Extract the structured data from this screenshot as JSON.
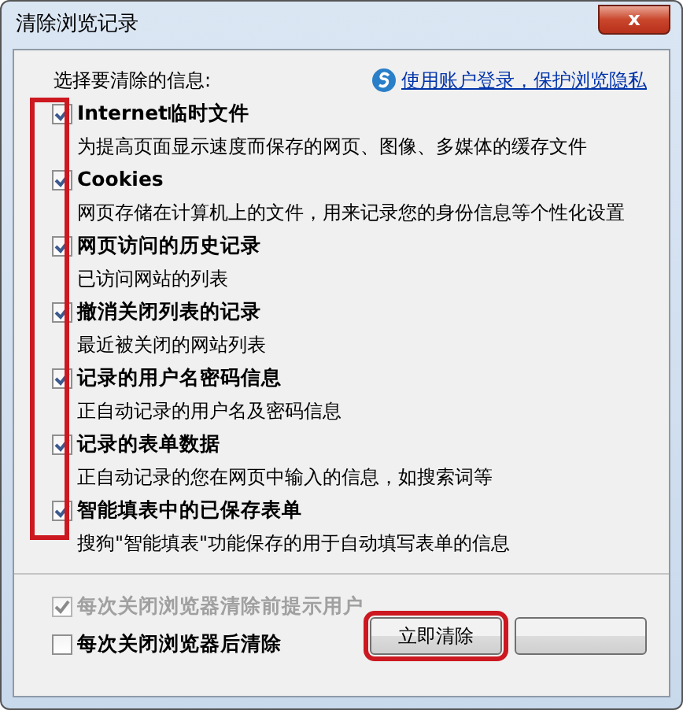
{
  "window": {
    "title": "清除浏览记录",
    "close_label": "x"
  },
  "heading": "选择要清除的信息:",
  "account_link": "使用账户登录，保护浏览隐私",
  "checkbox_column_highlighted": true,
  "items": [
    {
      "label": "Internet临时文件",
      "description": "为提高页面显示速度而保存的网页、图像、多媒体的缓存文件",
      "checked": true
    },
    {
      "label": "Cookies",
      "description": "网页存储在计算机上的文件，用来记录您的身份信息等个性化设置",
      "checked": true
    },
    {
      "label": "网页访问的历史记录",
      "description": "已访问网站的列表",
      "checked": true
    },
    {
      "label": "撤消关闭列表的记录",
      "description": "最近被关闭的网站列表",
      "checked": true
    },
    {
      "label": "记录的用户名密码信息",
      "description": "正自动记录的用户名及密码信息",
      "checked": true
    },
    {
      "label": "记录的表单数据",
      "description": "正自动记录的您在网页中输入的信息，如搜索词等",
      "checked": true
    },
    {
      "label": "智能填表中的已保存表单",
      "description": "搜狗\"智能填表\"功能保存的用于自动填写表单的信息",
      "checked": true
    }
  ],
  "options": [
    {
      "label": "每次关闭浏览器清除前提示用户",
      "checked": true,
      "disabled": true
    },
    {
      "label": "每次关闭浏览器后清除",
      "checked": false,
      "disabled": false
    }
  ],
  "buttons": [
    {
      "label": "立即清除",
      "highlighted": true
    },
    {
      "highlighted": false
    }
  ]
}
